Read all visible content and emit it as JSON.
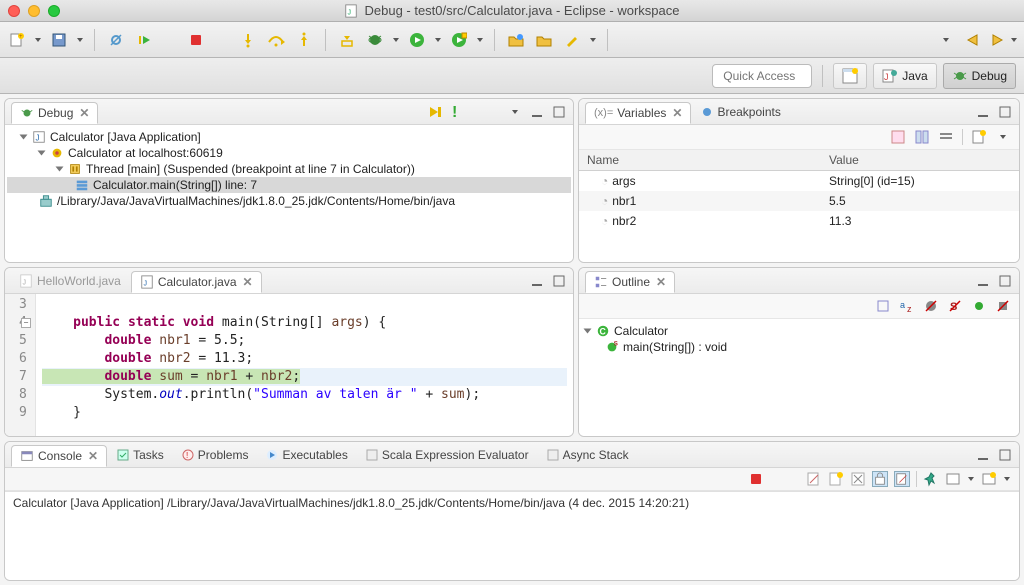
{
  "window": {
    "title": "Debug - test0/src/Calculator.java - Eclipse - workspace"
  },
  "perspective": {
    "quick_access_placeholder": "Quick Access",
    "java_label": "Java",
    "debug_label": "Debug"
  },
  "debug_view": {
    "tab_label": "Debug",
    "tree": {
      "app": "Calculator [Java Application]",
      "target": "Calculator at localhost:60619",
      "thread": "Thread [main] (Suspended (breakpoint at line 7 in Calculator))",
      "frame": "Calculator.main(String[]) line: 7",
      "jvm": "/Library/Java/JavaVirtualMachines/jdk1.8.0_25.jdk/Contents/Home/bin/java"
    }
  },
  "variables_view": {
    "tab_label": "Variables",
    "breakpoints_tab": "Breakpoints",
    "col_name": "Name",
    "col_value": "Value",
    "rows": [
      {
        "name": "args",
        "value": "String[0]  (id=15)"
      },
      {
        "name": "nbr1",
        "value": "5.5"
      },
      {
        "name": "nbr2",
        "value": "11.3"
      }
    ]
  },
  "editor": {
    "inactive_tab": "HelloWorld.java",
    "active_tab": "Calculator.java",
    "lines": [
      {
        "n": "3",
        "text": ""
      },
      {
        "n": "4",
        "text": "    public static void main(String[] args) {"
      },
      {
        "n": "5",
        "text": "        double nbr1 = 5.5;"
      },
      {
        "n": "6",
        "text": "        double nbr2 = 11.3;"
      },
      {
        "n": "7",
        "text": "        double sum = nbr1 + nbr2;"
      },
      {
        "n": "8",
        "text": "        System.out.println(\"Summan av talen är \" + sum);"
      },
      {
        "n": "9",
        "text": "    }"
      }
    ],
    "string_literal": "\"Summan av talen är \"",
    "current_line": 7
  },
  "outline": {
    "tab_label": "Outline",
    "class": "Calculator",
    "method": "main(String[]) : void"
  },
  "console": {
    "tab_label": "Console",
    "tabs": [
      "Tasks",
      "Problems",
      "Executables",
      "Scala Expression Evaluator",
      "Async Stack"
    ],
    "status": "Calculator [Java Application] /Library/Java/JavaVirtualMachines/jdk1.8.0_25.jdk/Contents/Home/bin/java (4 dec. 2015 14:20:21)"
  }
}
